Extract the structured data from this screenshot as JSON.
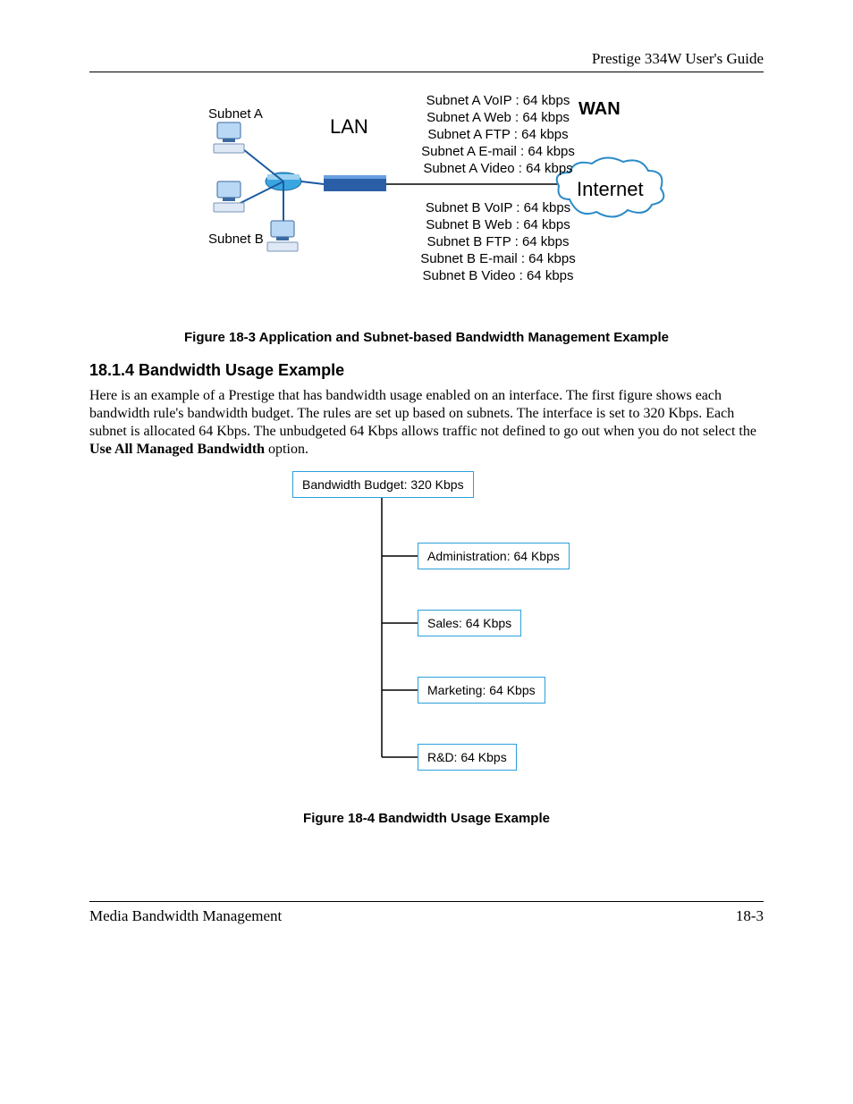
{
  "header": {
    "title": "Prestige 334W User's Guide"
  },
  "fig183": {
    "subnetA": "Subnet A",
    "subnetB": "Subnet B",
    "lan": "LAN",
    "wan": "WAN",
    "internet": "Internet",
    "listA": [
      "Subnet A VoIP : 64 kbps",
      "Subnet A Web : 64 kbps",
      "Subnet A FTP : 64 kbps",
      "Subnet A E-mail : 64 kbps",
      "Subnet A Video : 64 kbps"
    ],
    "listB": [
      "Subnet B VoIP : 64 kbps",
      "Subnet B Web : 64 kbps",
      "Subnet B FTP : 64 kbps",
      "Subnet B E-mail : 64 kbps",
      "Subnet B Video : 64 kbps"
    ],
    "caption": "Figure 18-3 Application and Subnet-based Bandwidth Management Example"
  },
  "section": {
    "heading": "18.1.4 Bandwidth Usage Example",
    "p1a": "Here is an example of a Prestige that has bandwidth usage enabled on an interface. The first figure shows each bandwidth rule's bandwidth budget. The rules are set up based on subnets. The interface is set to 320 Kbps. Each subnet is allocated 64 Kbps. The unbudgeted 64 Kbps allows traffic not defined to go out when you do not select the ",
    "p1bold": "Use All Managed Bandwidth",
    "p1b": " option."
  },
  "fig184": {
    "root": "Bandwidth Budget: 320 Kbps",
    "nodes": [
      "Administration: 64 Kbps",
      "Sales: 64 Kbps",
      "Marketing: 64 Kbps",
      "R&D: 64 Kbps"
    ],
    "caption": "Figure 18-4 Bandwidth Usage Example"
  },
  "footer": {
    "left": "Media Bandwidth Management",
    "right": "18-3"
  },
  "chart_data": {
    "type": "table",
    "title": "Bandwidth Budget: 320 Kbps",
    "categories": [
      "Administration",
      "Sales",
      "Marketing",
      "R&D"
    ],
    "values": [
      64,
      64,
      64,
      64
    ],
    "unit": "Kbps"
  }
}
